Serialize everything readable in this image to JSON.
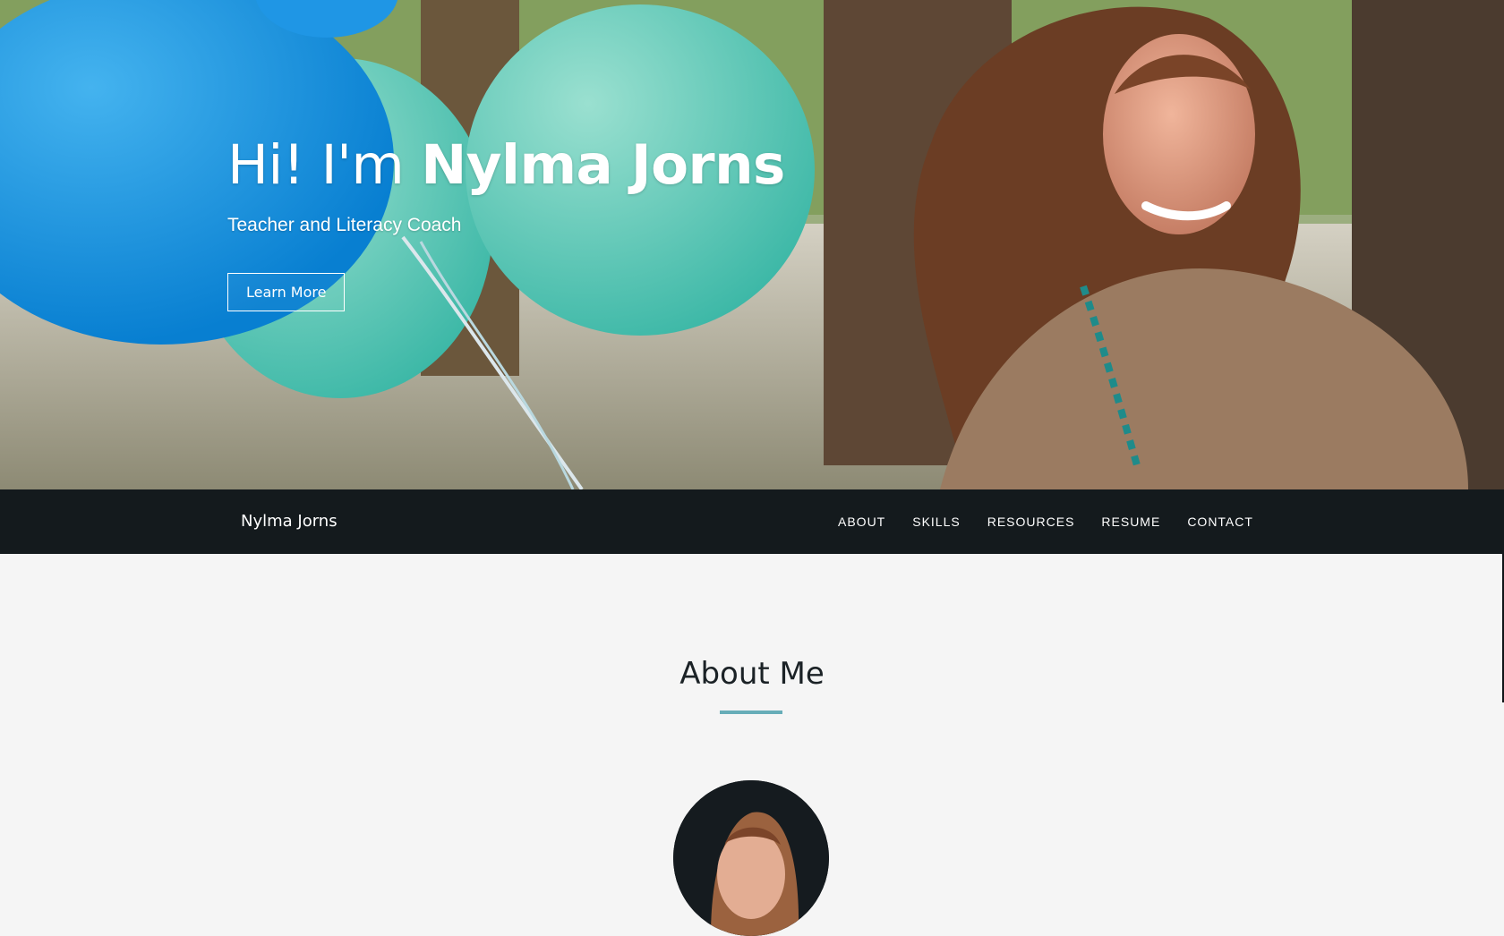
{
  "hero": {
    "greeting": "Hi! I'm ",
    "name": "Nylma Jorns",
    "subtitle": "Teacher and Literacy Coach",
    "button_label": "Learn More"
  },
  "navbar": {
    "brand": "Nylma Jorns",
    "links": [
      "ABOUT",
      "SKILLS",
      "RESOURCES",
      "RESUME",
      "CONTACT"
    ]
  },
  "about": {
    "title": "About Me"
  },
  "colors": {
    "nav_background": "#141a1d",
    "accent": "#67adb8",
    "page_background": "#f5f5f5"
  }
}
